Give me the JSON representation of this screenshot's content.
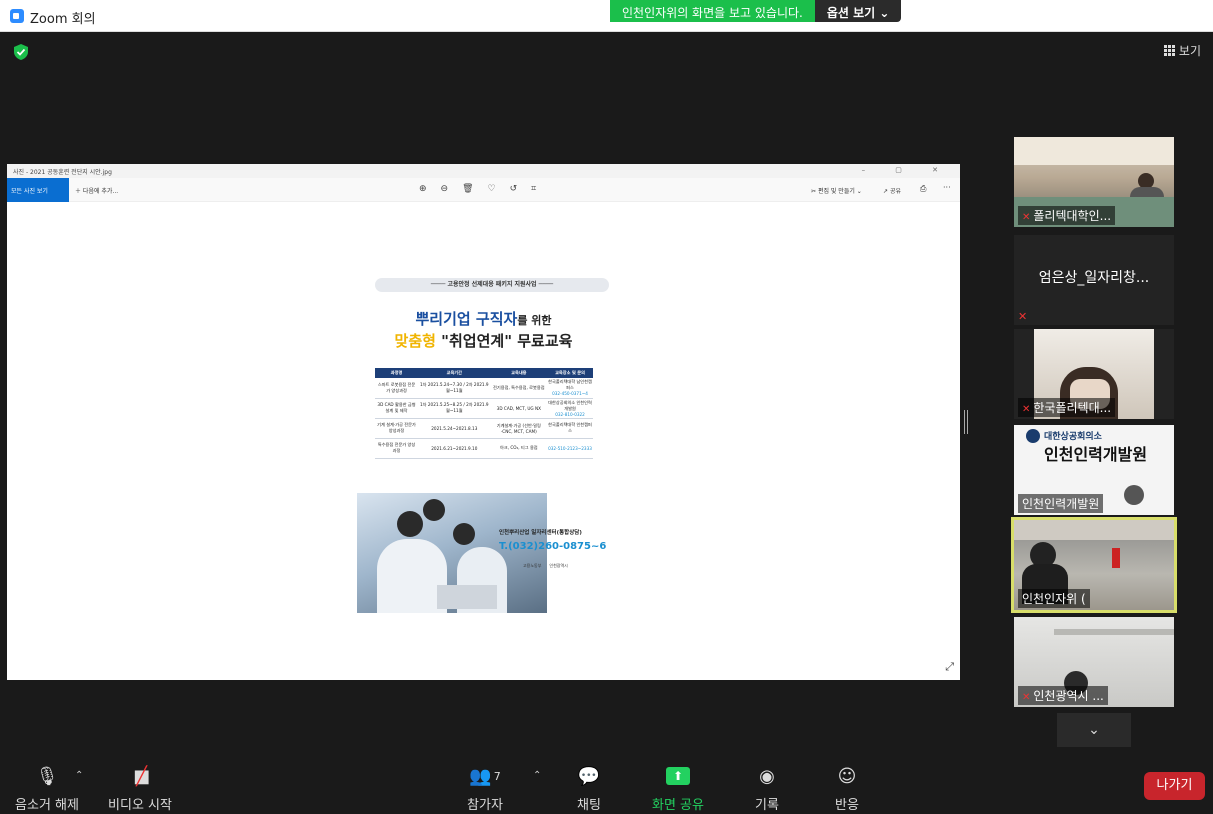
{
  "window": {
    "title": "Zoom 회의"
  },
  "banner": {
    "message": "인천인자위의 화면을 보고 있습니다.",
    "options": "옵션 보기 ⌄"
  },
  "view_button": {
    "label": "보기"
  },
  "photo_viewer": {
    "title": "사진 - 2021 공동훈련 전단지 시안.jpg",
    "window_controls": "–  ▢  ✕",
    "all_photos": "모든 사진 보기",
    "add_to": "다음에 추가...",
    "edit_create": "편집 및 만들기 ⌄",
    "share": "공유",
    "more": "···"
  },
  "flyer": {
    "top_banner": "──── 고용안정 선제대응 패키지 지원사업 ────",
    "headline1_a": "뿌리기업 구직자",
    "headline1_b": "를 위한",
    "headline2_a": "맞춤형",
    "headline2_b": " \"취업연계\" 무료교육",
    "table_headers": [
      "과정명",
      "교육기간",
      "교육내용",
      "교육장소 및 문의"
    ],
    "rows": [
      [
        "스마트 로봇용접 전문가 양성과정",
        "1차 2021.5.24~7.30 / 2차 2021.9월~11월",
        "전기용접, 특수용접, 로봇용접",
        "한국폴리텍대학 남인천캠퍼스",
        "032-450-0371~4"
      ],
      [
        "3D CAD 활용한 금형설계 및 제작",
        "1차 2021.5.25~8.25 / 2차 2021.9월~11월",
        "3D CAD, MCT, UG NX",
        "대한상공회의소 인천인력개발원",
        "032-810-0322"
      ],
      [
        "기계 설계·가공 전문가 양성과정",
        "2021.5.24~2021.8.13",
        "기계설계·가공 (선반·밀링·CNC, MCT, CAM)",
        "한국폴리텍대학 인천캠퍼스",
        ""
      ],
      [
        "특수용접 전문가 양성과정",
        "2021.6.21~2021.9.10",
        "아크, CO₂, 티그 용접",
        "",
        "032-510-2123~2333"
      ]
    ],
    "center_name": "인천뿌리산업 일자리센터(통합상담)",
    "phone": "T.(032)260-0875~6",
    "logo1": "고용노동부",
    "logo2": "인천광역시"
  },
  "participants": [
    {
      "name": "폴리텍대학인...",
      "muted": true
    },
    {
      "name": "엄은상_일자리창...",
      "muted": true
    },
    {
      "name": "한국폴리텍대...",
      "muted": true
    },
    {
      "name": "인천인력개발원",
      "muted": false,
      "sign_line1": "대한상공회의소",
      "sign_line2": "인천인력개발원"
    },
    {
      "name": "인천인자위 (",
      "muted": false,
      "active": true
    },
    {
      "name": "인천광역시 ...",
      "muted": true
    }
  ],
  "toolbar": {
    "unmute": "음소거 해제",
    "start_video": "비디오 시작",
    "participants": "참가자",
    "participants_count": "7",
    "chat": "채팅",
    "share_screen": "화면 공유",
    "record": "기록",
    "reactions": "반응",
    "leave": "나가기"
  },
  "colors": {
    "accent_green": "#23d160",
    "leave_red": "#c8252c",
    "active_border": "#d8de6a",
    "brand_blue": "#2d8cff"
  }
}
